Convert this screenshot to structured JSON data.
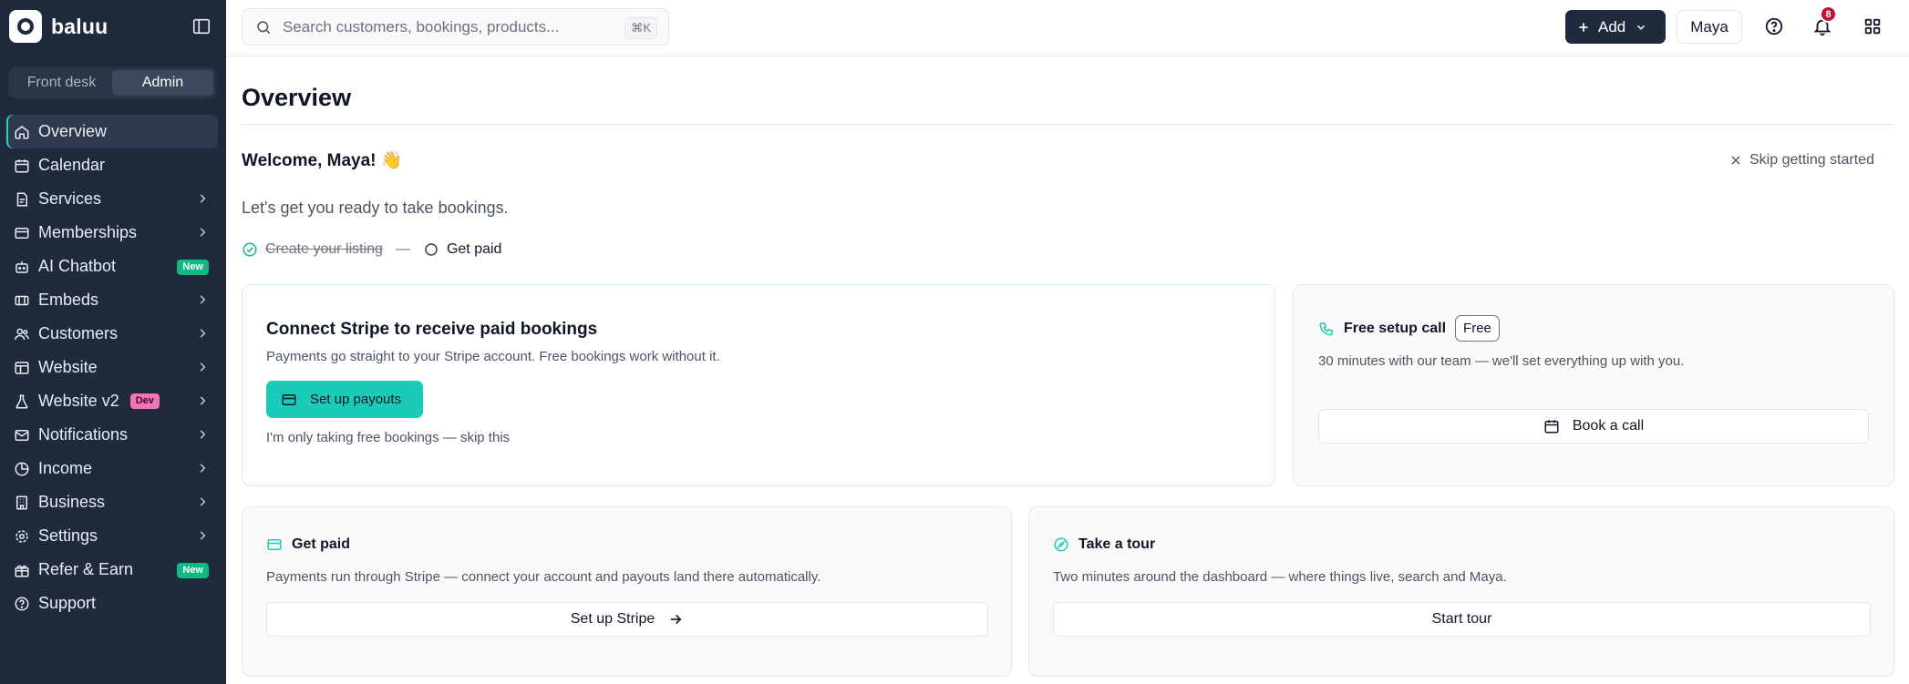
{
  "brand": {
    "name": "baluu"
  },
  "mode_switch": {
    "front_desk": "Front desk",
    "admin": "Admin",
    "active": "Admin"
  },
  "sidebar": {
    "items": [
      {
        "label": "Overview",
        "icon": "home-icon",
        "active": true
      },
      {
        "label": "Calendar",
        "icon": "calendar-icon"
      },
      {
        "label": "Services",
        "icon": "services-icon",
        "chevron": true
      },
      {
        "label": "Memberships",
        "icon": "membership-card-icon",
        "chevron": true
      },
      {
        "label": "AI Chatbot",
        "icon": "bot-icon",
        "badge": "New"
      },
      {
        "label": "Embeds",
        "icon": "embed-icon",
        "chevron": true
      },
      {
        "label": "Customers",
        "icon": "users-icon",
        "chevron": true
      },
      {
        "label": "Website",
        "icon": "website-icon",
        "chevron": true
      },
      {
        "label": "Website v2",
        "icon": "flask-icon",
        "badge": "Dev",
        "chevron": true
      },
      {
        "label": "Notifications",
        "icon": "mail-icon",
        "chevron": true
      },
      {
        "label": "Income",
        "icon": "pie-chart-icon",
        "chevron": true
      },
      {
        "label": "Business",
        "icon": "building-icon",
        "chevron": true
      },
      {
        "label": "Settings",
        "icon": "gear-icon",
        "chevron": true
      },
      {
        "label": "Refer & Earn",
        "icon": "gift-icon",
        "badge": "New"
      },
      {
        "label": "Support",
        "icon": "help-circle-icon"
      }
    ]
  },
  "topbar": {
    "search_placeholder": "Search customers, bookings, products...",
    "search_shortcut": "⌘K",
    "add_label": "Add",
    "user_label": "Maya",
    "notification_count": "8"
  },
  "main": {
    "title": "Overview",
    "welcome": "Welcome, Maya! 👋",
    "skip_label": "Skip getting started",
    "subtitle": "Let's get you ready to take bookings.",
    "steps": {
      "done": "Create your listing",
      "separator": "—",
      "todo": "Get paid"
    }
  },
  "cards": {
    "stripe": {
      "title": "Connect Stripe to receive paid bookings",
      "text": "Payments go straight to your Stripe account. Free bookings work without it.",
      "button": "Set up payouts",
      "skip": "I'm only taking free bookings — skip this"
    },
    "setup_call": {
      "title": "Free setup call",
      "pill": "Free",
      "text": "30 minutes with our team — we'll set everything up with you.",
      "button": "Book a call"
    },
    "get_paid": {
      "title": "Get paid",
      "text": "Payments run through Stripe — connect your account and payouts land there automatically.",
      "button": "Set up Stripe"
    },
    "tour": {
      "title": "Take a tour",
      "text": "Two minutes around the dashboard — where things live, search and Maya.",
      "button": "Start tour"
    }
  },
  "colors": {
    "sidebar_bg": "#1f2a3d",
    "accent_teal": "#19cbb8",
    "badge_new": "#10b981",
    "badge_dev": "#f472b6",
    "notif_badge": "#be123c"
  }
}
